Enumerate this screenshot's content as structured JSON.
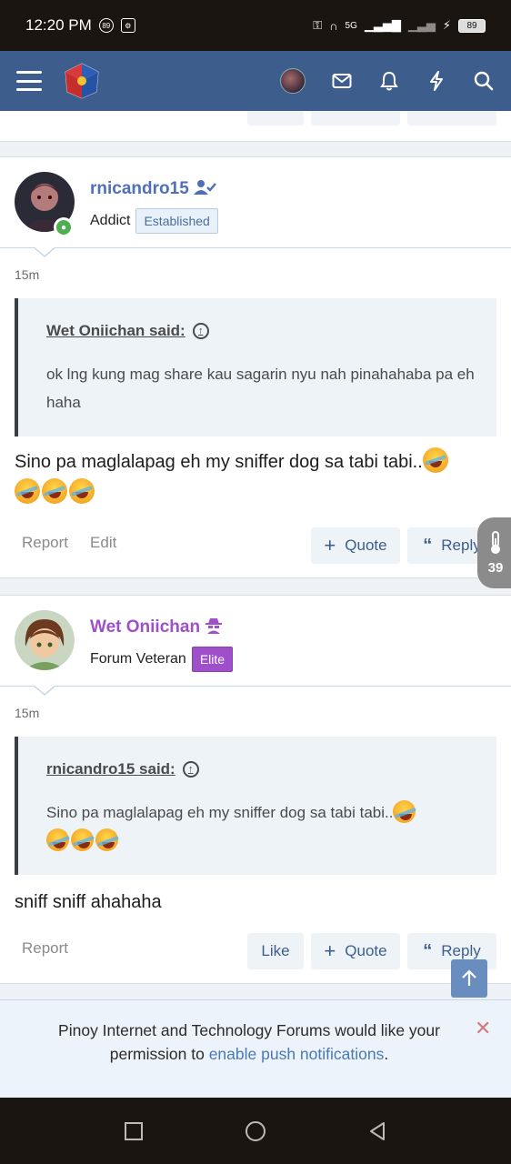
{
  "status_bar": {
    "time": "12:20 PM",
    "indicator_1": "89",
    "network_label": "5G",
    "battery": "89"
  },
  "app_bar": {
    "menu_icon": "hamburger-icon",
    "logo": "forum-logo",
    "icons": [
      "user-avatar",
      "mail-icon",
      "bell-icon",
      "bolt-icon",
      "search-icon"
    ]
  },
  "posts": [
    {
      "username": "rnicandro15",
      "username_color": "#4f6fb7",
      "user_title": "Addict",
      "badge": "Established",
      "time": "15m",
      "quote_author": "Wet Oniichan said:",
      "quote_text": "ok lng kung mag share kau sagarin nyu nah pinahahaba pa eh haha",
      "body_text": "Sino pa maglalapag eh my sniffer dog sa tabi tabi..",
      "actions": [
        "Report",
        "Edit"
      ],
      "buttons": {
        "quote": "Quote",
        "reply": "Reply"
      }
    },
    {
      "username": "Wet Oniichan",
      "username_color": "#9f4fc9",
      "user_title": "Forum Veteran",
      "badge": "Elite",
      "time": "15m",
      "quote_author": "rnicandro15 said:",
      "quote_text": "Sino pa maglalapag eh my sniffer dog sa tabi tabi..",
      "body_text": "sniff sniff ahahaha",
      "actions": [
        "Report"
      ],
      "buttons": {
        "like": "Like",
        "quote": "Quote",
        "reply": "Reply"
      }
    }
  ],
  "side_widget": {
    "count": "39"
  },
  "notice": {
    "text_before": "Pinoy Internet and Technology Forums would like your permission to ",
    "link": "enable push notifications",
    "text_after": "."
  },
  "colors": {
    "header": "#3d5e8c",
    "accent": "#3d5e8c"
  }
}
